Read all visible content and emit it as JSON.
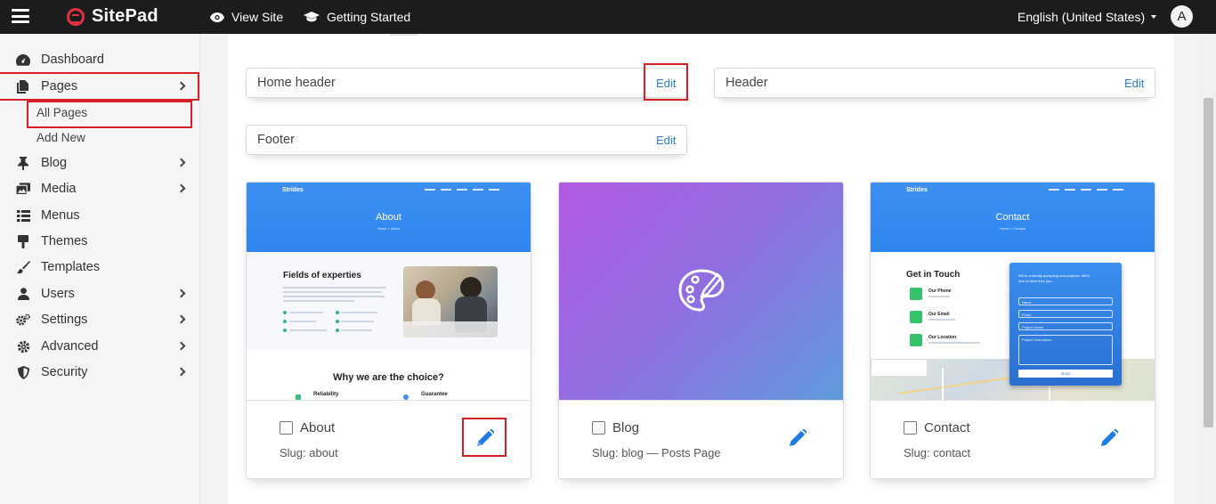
{
  "topbar": {
    "brand": "SitePad",
    "view_site": "View Site",
    "getting_started": "Getting Started",
    "language": "English (United States)",
    "avatar_letter": "A"
  },
  "sidebar": {
    "items": [
      {
        "label": "Dashboard",
        "icon": "dashboard-icon"
      },
      {
        "label": "Pages",
        "icon": "pages-icon"
      },
      {
        "label": "Blog",
        "icon": "pin-icon"
      },
      {
        "label": "Media",
        "icon": "media-icon"
      },
      {
        "label": "Menus",
        "icon": "menu-list-icon"
      },
      {
        "label": "Themes",
        "icon": "brush-icon"
      },
      {
        "label": "Templates",
        "icon": "paintbrush-icon"
      },
      {
        "label": "Users",
        "icon": "user-icon"
      },
      {
        "label": "Settings",
        "icon": "gears-icon"
      },
      {
        "label": "Advanced",
        "icon": "gear-icon"
      },
      {
        "label": "Security",
        "icon": "shield-icon"
      }
    ],
    "pages_sub": {
      "all_pages": "All Pages",
      "add_new": "Add New"
    }
  },
  "regions": {
    "home_header": {
      "label": "Home header",
      "edit": "Edit"
    },
    "header": {
      "label": "Header",
      "edit": "Edit"
    },
    "footer": {
      "label": "Footer",
      "edit": "Edit"
    }
  },
  "cards": [
    {
      "title": "About",
      "slug": "Slug: about",
      "thumb": {
        "brand": "Strides",
        "heading": "About",
        "crumb": "Home > About",
        "section": "Fields of experties",
        "section2": "Why we are the choice?",
        "features": [
          "Reliability",
          "Guarantee"
        ]
      }
    },
    {
      "title": "Blog",
      "slug": "Slug: blog — Posts Page"
    },
    {
      "title": "Contact",
      "slug": "Slug: contact",
      "thumb": {
        "brand": "Strides",
        "heading": "Contact",
        "crumb": "Home > Contact",
        "section": "Get in Touch",
        "items": [
          "Our Phone",
          "Our Email",
          "Our Location"
        ],
        "form_title": "We're currently accepting new projects. We'd love to hear from you.",
        "fields": [
          "Name",
          "Email",
          "Project Name",
          "Project Description"
        ],
        "submit": "SEND"
      }
    }
  ],
  "colors": {
    "topbar": "#1c1c1c",
    "accent": "#2a7ed2",
    "highlight": "#d61f26",
    "brand": "#e0313f"
  }
}
